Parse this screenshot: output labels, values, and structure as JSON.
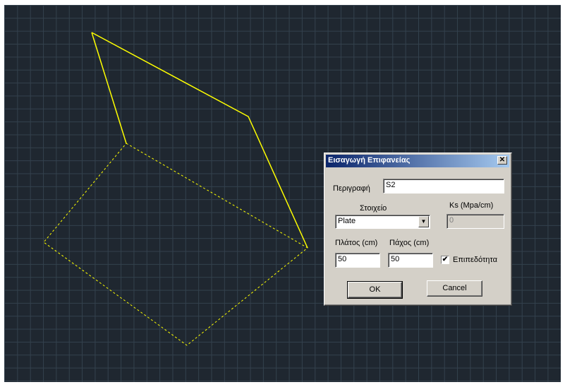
{
  "dialog": {
    "title": "Εισαγωγή Επιφανείας",
    "close_glyph": "✕",
    "description_label": "Περιγραφή",
    "description_value": "S2",
    "element_label": "Στοιχείο",
    "element_value": "Plate",
    "ks_label": "Ks (Mpa/cm)",
    "ks_value": "0",
    "width_label": "Πλάτος (cm)",
    "width_value": "50",
    "thickness_label": "Πάχος (cm)",
    "thickness_value": "50",
    "planarity_label": "Επιπεδότητα",
    "planarity_checked": true,
    "ok_label": "OK",
    "cancel_label": "Cancel"
  },
  "colors": {
    "canvas_background": "#1f2730",
    "grid": "#33414d",
    "drawing": "#ffff00",
    "titlebar_start": "#0a246a",
    "dialog_face": "#d4d0c8"
  }
}
